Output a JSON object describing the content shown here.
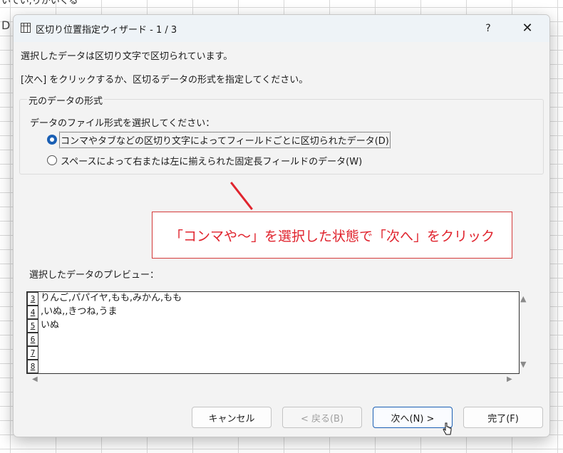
{
  "background": {
    "top_text": "いてい,りかいくる",
    "column_letter": "D"
  },
  "dialog": {
    "title": "区切り位置指定ウィザード - 1 / 3",
    "help_label": "?",
    "close_label": "✕",
    "line1": "選択したデータは区切り文字で区切られています。",
    "line2": "[次へ] をクリックするか、区切るデータの形式を指定してください。",
    "group": {
      "label": "元のデータの形式",
      "choose_label": "データのファイル形式を選択してください：",
      "options": [
        {
          "label": "コンマやタブなどの区切り文字によってフィールドごとに区切られたデータ(D)",
          "checked": true
        },
        {
          "label": "スペースによって右または左に揃えられた固定長フィールドのデータ(W)",
          "checked": false
        }
      ]
    },
    "callout": "「コンマや～」を選択した状態で「次へ」をクリック",
    "preview": {
      "label": "選択したデータのプレビュー：",
      "rows": [
        {
          "num": "3",
          "text": "りんご,パパイヤ,もも,みかん,もも"
        },
        {
          "num": "4",
          "text": ",いぬ,,きつね,うま"
        },
        {
          "num": "5",
          "text": "いぬ"
        },
        {
          "num": "6",
          "text": ""
        },
        {
          "num": "7",
          "text": ""
        },
        {
          "num": "8",
          "text": ""
        }
      ]
    },
    "buttons": {
      "cancel": "キャンセル",
      "back": "< 戻る(B)",
      "next": "次へ(N) >",
      "finish": "完了(F)"
    },
    "accent_color": "#1a5fb4",
    "callout_color": "#e0242e"
  }
}
